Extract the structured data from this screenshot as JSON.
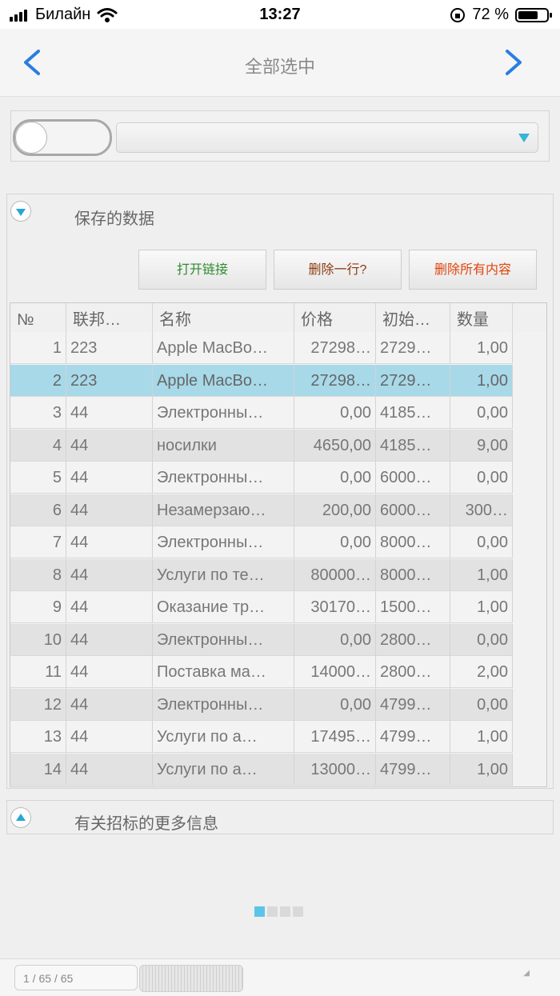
{
  "status": {
    "carrier": "Билайн",
    "time": "13:27",
    "battery": "72 %",
    "battery_level": 0.72
  },
  "nav": {
    "title": "全部选中"
  },
  "section1": {
    "title": "保存的数据"
  },
  "buttons": {
    "open_link": "打开链接",
    "open_link_color": "#2e8b2e",
    "delete_row": "删除一行?",
    "delete_row_color": "#8b3a10",
    "delete_all": "删除所有内容",
    "delete_all_color": "#e0440e"
  },
  "table": {
    "headers": [
      "№",
      "联邦…",
      "名称",
      "价格",
      "初始…",
      "数量"
    ],
    "rows": [
      [
        "1",
        "223",
        "Apple MacBo…",
        "27298…",
        "2729…",
        "1,00"
      ],
      [
        "2",
        "223",
        "Apple MacBo…",
        "27298…",
        "2729…",
        "1,00"
      ],
      [
        "3",
        "44",
        "Электронны…",
        "0,00",
        "4185…",
        "0,00"
      ],
      [
        "4",
        "44",
        "носилки",
        "4650,00",
        "4185…",
        "9,00"
      ],
      [
        "5",
        "44",
        "Электронны…",
        "0,00",
        "6000…",
        "0,00"
      ],
      [
        "6",
        "44",
        "Незамерзаю…",
        "200,00",
        "6000…",
        "300…"
      ],
      [
        "7",
        "44",
        "Электронны…",
        "0,00",
        "8000…",
        "0,00"
      ],
      [
        "8",
        "44",
        "Услуги по те…",
        "80000…",
        "8000…",
        "1,00"
      ],
      [
        "9",
        "44",
        "Оказание тр…",
        "30170…",
        "1500…",
        "1,00"
      ],
      [
        "10",
        "44",
        "Электронны…",
        "0,00",
        "2800…",
        "0,00"
      ],
      [
        "11",
        "44",
        "Поставка ма…",
        "14000…",
        "2800…",
        "2,00"
      ],
      [
        "12",
        "44",
        "Электронны…",
        "0,00",
        "4799…",
        "0,00"
      ],
      [
        "13",
        "44",
        "Услуги по а…",
        "17495…",
        "4799…",
        "1,00"
      ],
      [
        "14",
        "44",
        "Услуги по а…",
        "13000…",
        "4799…",
        "1,00"
      ]
    ],
    "selected_row": 2
  },
  "section2": {
    "title": "有关招标的更多信息"
  },
  "pager": {
    "text": "1 / 65 / 65",
    "resize_glyph": "◢"
  },
  "colors": {
    "accent": "#2a7de1",
    "selection": "#a8d9e9",
    "section_icon": "#27a7d6"
  }
}
